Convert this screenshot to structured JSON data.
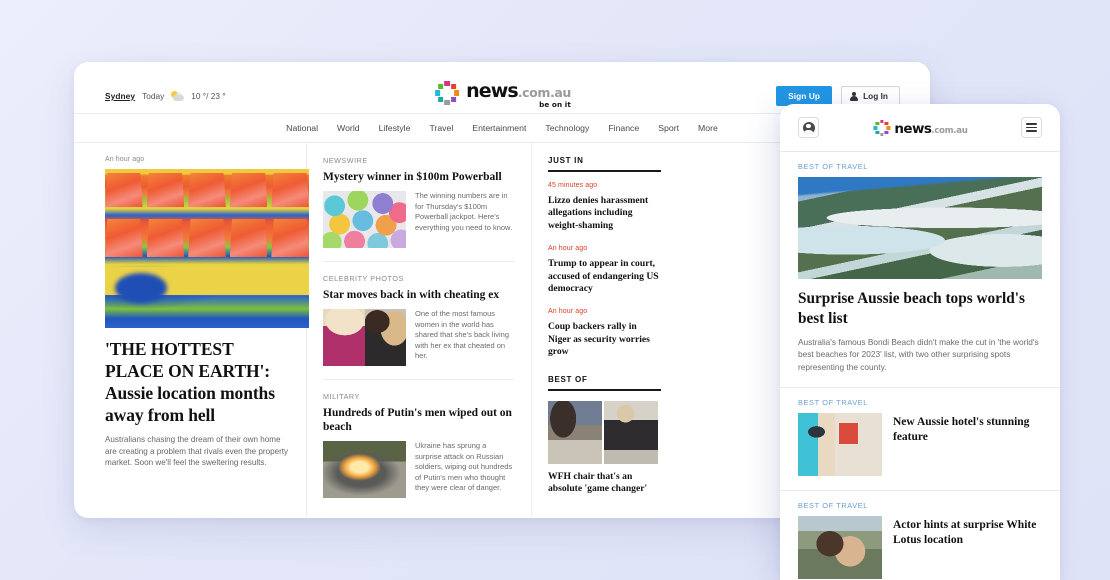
{
  "desktop": {
    "weather": {
      "city": "Sydney",
      "day": "Today",
      "icon": "partly-cloudy-icon",
      "temps": "10 °/ 23 °"
    },
    "logo": {
      "main": "news",
      "domain": ".com.au",
      "tagline": "be on it"
    },
    "auth": {
      "signup": "Sign Up",
      "login": "Log In"
    },
    "nav": [
      "National",
      "World",
      "Lifestyle",
      "Travel",
      "Entertainment",
      "Technology",
      "Finance",
      "Sport",
      "More"
    ],
    "hero": {
      "timestamp": "An hour ago",
      "headline": "'THE HOTTEST PLACE ON EARTH': Aussie location months away from hell",
      "standfirst": "Australians chasing the dream of their own home are creating a problem that rivals even the property market. Soon we'll feel the sweltering results."
    },
    "mid_stories": [
      {
        "kicker": "NEWSWIRE",
        "headline": "Mystery winner in $100m Powerball",
        "body": "The winning numbers are in for Thursday's $100m Powerball jackpot. Here's everything you need to know."
      },
      {
        "kicker": "CELEBRITY PHOTOS",
        "headline": "Star moves back in with cheating ex",
        "body": "One of the most famous women in the world has shared that she's back living with her ex that cheated on her."
      },
      {
        "kicker": "MILITARY",
        "headline": "Hundreds of Putin's men wiped out on beach",
        "body": "Ukraine has sprung a surprise attack on Russian soldiers, wiping out hundreds of Putin's men who thought they were clear of danger."
      }
    ],
    "just_in": {
      "title": "JUST IN",
      "items": [
        {
          "timestamp": "45 minutes ago",
          "headline": "Lizzo denies harassment allegations including weight-shaming"
        },
        {
          "timestamp": "An hour ago",
          "headline": "Trump to appear in court, accused of endangering US democracy"
        },
        {
          "timestamp": "An hour ago",
          "headline": "Coup backers rally in Niger as security worries grow"
        }
      ]
    },
    "best_of": {
      "title": "BEST OF",
      "headline": "WFH chair that's an absolute 'game changer'"
    }
  },
  "mobile": {
    "logo": {
      "main": "news",
      "domain": ".com.au"
    },
    "lead": {
      "kicker": "BEST OF TRAVEL",
      "headline": "Surprise Aussie beach tops world's best list",
      "standfirst": "Australia's famous Bondi Beach didn't make the cut in 'the world's best beaches for 2023' list, with two other surprising spots representing the county."
    },
    "items": [
      {
        "kicker": "BEST OF TRAVEL",
        "headline": "New Aussie hotel's stunning feature"
      },
      {
        "kicker": "BEST OF TRAVEL",
        "headline": "Actor hints at surprise White Lotus location"
      }
    ]
  },
  "colors": {
    "accent_blue": "#2196e3",
    "timestamp_red": "#d8402a",
    "mobile_kicker_blue": "#6b9fd0",
    "page_background": "#e3e7fa"
  },
  "logo_dot_colors": [
    "#d63384",
    "#e8402a",
    "#f08a1e",
    "#8a4fc4",
    "#9b9b9b",
    "#1fa8a0",
    "#22b8d8",
    "#5cb82e"
  ]
}
